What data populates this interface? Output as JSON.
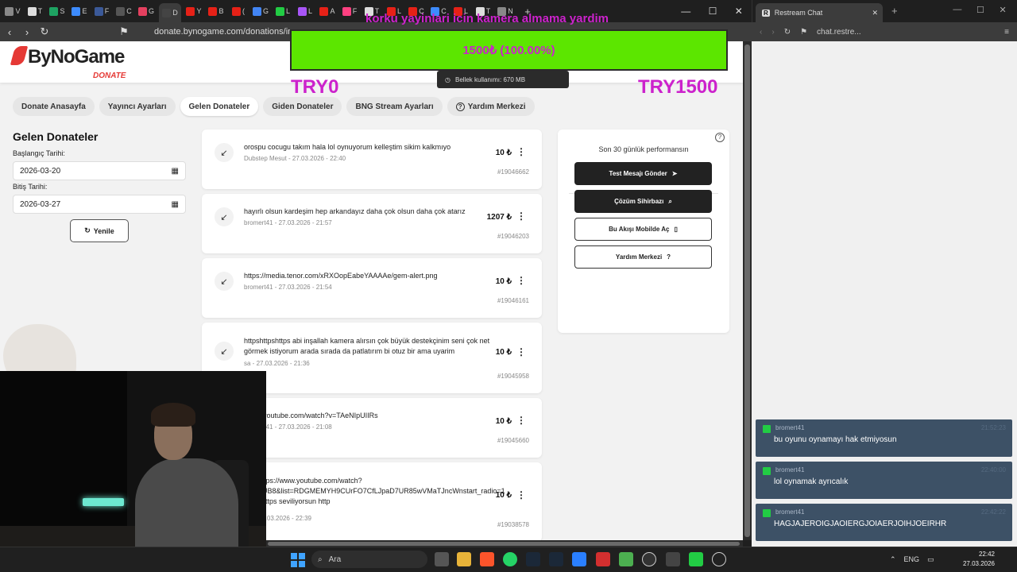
{
  "browser": {
    "url": "donate.bynogame.com/donations/incom",
    "tabs": [
      {
        "label": "V",
        "color": "#888"
      },
      {
        "label": "T",
        "color": "#ddd"
      },
      {
        "label": "S",
        "color": "#1ea362"
      },
      {
        "label": "E",
        "color": "#3d8bfd"
      },
      {
        "label": "F",
        "color": "#3b5998"
      },
      {
        "label": "C",
        "color": "#555"
      },
      {
        "label": "G",
        "color": "#e4405f"
      },
      {
        "label": "D",
        "color": "#444",
        "active": true
      },
      {
        "label": "Y",
        "color": "#e62117"
      },
      {
        "label": "B",
        "color": "#e62117"
      },
      {
        "label": "(",
        "color": "#e62117"
      },
      {
        "label": "G",
        "color": "#4285f4"
      },
      {
        "label": "L",
        "color": "#22cc44"
      },
      {
        "label": "L",
        "color": "#a855f7"
      },
      {
        "label": "A",
        "color": "#e62117"
      },
      {
        "label": "F",
        "color": "#ff4081"
      },
      {
        "label": "T",
        "color": "#ddd"
      },
      {
        "label": "L",
        "color": "#e62117"
      },
      {
        "label": "C",
        "color": "#e62117"
      },
      {
        "label": "C",
        "color": "#3d8bfd"
      },
      {
        "label": "L",
        "color": "#e62117"
      },
      {
        "label": "T",
        "color": "#ddd"
      },
      {
        "label": "N",
        "color": "#888"
      }
    ],
    "new_tab": "+"
  },
  "site": {
    "logo_text": "ByNoGame",
    "logo_sub": "DONATE",
    "nav": [
      {
        "label": "Donate Anasayfa"
      },
      {
        "label": "Yayıncı Ayarları"
      },
      {
        "label": "Gelen Donateler",
        "active": true
      },
      {
        "label": "Giden Donateler"
      },
      {
        "label": "BNG Stream Ayarları"
      },
      {
        "label": "Yardım Merkezi",
        "icon": "?"
      }
    ],
    "left": {
      "title": "Gelen Donateler",
      "start_label": "Başlangıç Tarihi:",
      "start_value": "2026-03-20",
      "end_label": "Bitiş Tarihi:",
      "end_value": "2026-03-27",
      "refresh_label": "Yenile"
    },
    "donations": [
      {
        "message": "orospu cocugu takım hala lol oynuyorum kelleştim sikim kalkmıyo",
        "user": "Dubstep Mesut",
        "date": "27.03.2026 - 22:40",
        "amount": "10 ₺",
        "id": "#19046662"
      },
      {
        "message": "hayırlı olsun kardeşim hep arkandayız daha çok olsun daha çok atarız",
        "user": "bromert41",
        "date": "27.03.2026 - 21:57",
        "amount": "1207 ₺",
        "id": "#19046203"
      },
      {
        "message": "https://media.tenor.com/xRXOopEabeYAAAAe/gem-alert.png",
        "user": "bromert41",
        "date": "27.03.2026 - 21:54",
        "amount": "10 ₺",
        "id": "#19046161"
      },
      {
        "message": "httpshttpshttps abi inşallah kamera alırsın çok büyük destekçinim seni çok net görmek istiyorum arada sırada da patlatırım bi otuz bir ama uyarim",
        "user": "sa",
        "date": "27.03.2026 - 21:36",
        "amount": "10 ₺",
        "id": "#19045958"
      },
      {
        "message": "/www.youtube.com/watch?v=TAeNIpUIIRs",
        "user": "bromert41",
        "date": "27.03.2026 - 21:08",
        "amount": "10 ₺",
        "id": "#19045660"
      },
      {
        "message": "ptth https://www.youtube.com/watch?cWndUB8&list=RDGMEMYH9CUrFO7CfLJpaD7UR85wVMaTJncWnstart_radio=1 https https seviliyorsun http",
        "user": "abi",
        "date": "26.03.2026 - 22:39",
        "amount": "10 ₺",
        "id": "#19038578"
      }
    ],
    "perf": {
      "title": "Son 30 günlük performansın",
      "value": "****₺",
      "buttons": [
        {
          "label": "Test Mesajı Gönder",
          "icon": "➤",
          "style": "dark"
        },
        {
          "label": "Çözüm Sihirbazı",
          "icon": "⌕",
          "style": "dark"
        },
        {
          "label": "Bu Akışı Mobilde Aç",
          "icon": "▯",
          "style": "light"
        },
        {
          "label": "Yardım Merkezi",
          "icon": "?",
          "style": "light"
        }
      ]
    }
  },
  "overlay": {
    "goal_title": "korku yayinlari icin kamera almama yardim",
    "progress_text": "1500₺ (100.00%)",
    "progress_fraction": 1.0,
    "min_label": "TRY0",
    "max_label": "TRY1500",
    "tooltip": "Bellek kullanımı: 670 MB",
    "bar_color": "#5ce600",
    "text_color": "#cc22cc"
  },
  "chat_browser": {
    "tab_title": "Restream Chat",
    "url": "chat.restre..."
  },
  "chat": [
    {
      "user": "bromert41",
      "time": "21:52:23",
      "text": "bu oyunu oynamayı hak etmiyosun"
    },
    {
      "user": "bromert41",
      "time": "22:40:00",
      "text": "lol oynamak ayrıcalık"
    },
    {
      "user": "bromert41",
      "time": "22:42:22",
      "text": "HAGJAJEROIGJAOIERGJOIAERJOIHJOEIRHR"
    }
  ],
  "taskbar": {
    "search_label": "Ara",
    "lang": "ENG",
    "time": "22:42",
    "date": "27.03.2026"
  }
}
